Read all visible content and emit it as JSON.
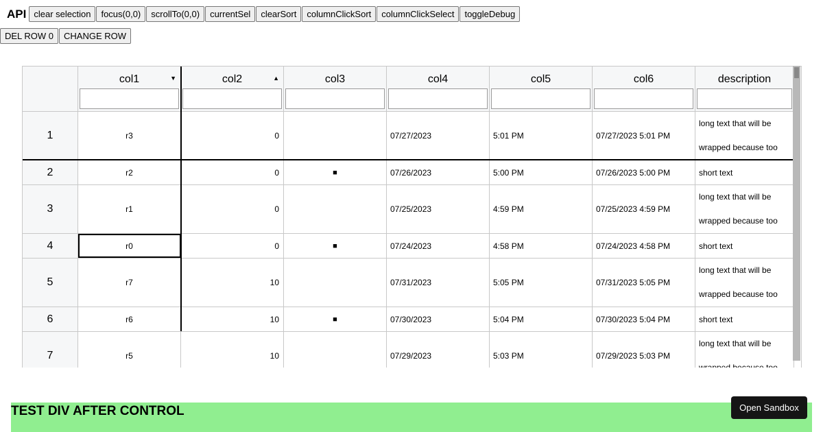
{
  "toolbar": {
    "api_label": "API",
    "buttons": [
      "clear selection",
      "focus(0,0)",
      "scrollTo(0,0)",
      "currentSel",
      "clearSort",
      "columnClickSort",
      "columnClickSelect",
      "toggleDebug"
    ]
  },
  "toolbar2": {
    "buttons": [
      "DEL ROW 0",
      "CHANGE ROW"
    ]
  },
  "grid": {
    "columns": [
      {
        "title": "col1",
        "sort": "▼"
      },
      {
        "title": "col2",
        "sort": "▲"
      },
      {
        "title": "col3",
        "sort": ""
      },
      {
        "title": "col4",
        "sort": ""
      },
      {
        "title": "col5",
        "sort": ""
      },
      {
        "title": "col6",
        "sort": ""
      },
      {
        "title": "description",
        "sort": ""
      }
    ],
    "rows": [
      {
        "num": "1",
        "col1": "r3",
        "col2": "0",
        "col3": "",
        "col4": "07/27/2023",
        "col5": "5:01 PM",
        "col6": "07/27/2023 5:01 PM",
        "desc": "long text that will be wrapped because too long",
        "tall": true
      },
      {
        "num": "2",
        "col1": "r2",
        "col2": "0",
        "col3": "■",
        "col4": "07/26/2023",
        "col5": "5:00 PM",
        "col6": "07/26/2023 5:00 PM",
        "desc": "short text",
        "tall": false
      },
      {
        "num": "3",
        "col1": "r1",
        "col2": "0",
        "col3": "",
        "col4": "07/25/2023",
        "col5": "4:59 PM",
        "col6": "07/25/2023 4:59 PM",
        "desc": "long text that will be wrapped because too long",
        "tall": true
      },
      {
        "num": "4",
        "col1": "r0",
        "col2": "0",
        "col3": "■",
        "col4": "07/24/2023",
        "col5": "4:58 PM",
        "col6": "07/24/2023 4:58 PM",
        "desc": "short text",
        "tall": false
      },
      {
        "num": "5",
        "col1": "r7",
        "col2": "10",
        "col3": "",
        "col4": "07/31/2023",
        "col5": "5:05 PM",
        "col6": "07/31/2023 5:05 PM",
        "desc": "long text that will be wrapped because too long",
        "tall": true
      },
      {
        "num": "6",
        "col1": "r6",
        "col2": "10",
        "col3": "■",
        "col4": "07/30/2023",
        "col5": "5:04 PM",
        "col6": "07/30/2023 5:04 PM",
        "desc": "short text",
        "tall": false
      },
      {
        "num": "7",
        "col1": "r5",
        "col2": "10",
        "col3": "",
        "col4": "07/29/2023",
        "col5": "5:03 PM",
        "col6": "07/29/2023 5:03 PM",
        "desc": "long text that will be wrapped because too long",
        "tall": true
      }
    ]
  },
  "test_div": {
    "text": "TEST DIV AFTER CONTROL"
  },
  "sandbox": {
    "label": "Open Sandbox"
  }
}
